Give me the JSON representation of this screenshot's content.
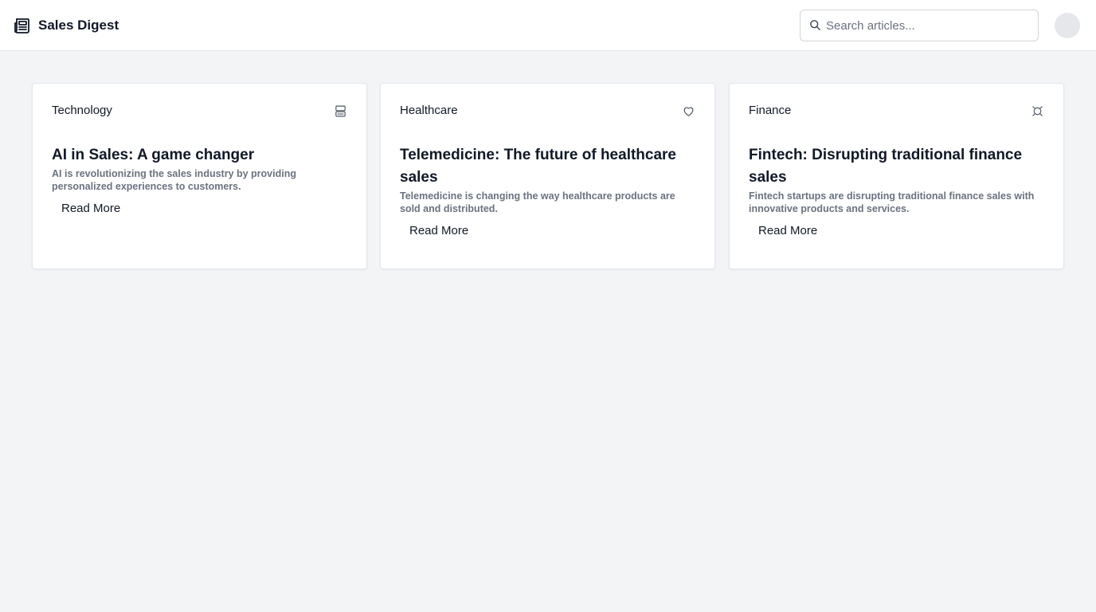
{
  "header": {
    "brand_icon": "newspaper-icon",
    "title": "Sales Digest",
    "search": {
      "icon": "search-icon",
      "placeholder": "Search articles...",
      "value": ""
    },
    "avatar_icon": "avatar"
  },
  "articles": [
    {
      "category": "Technology",
      "icon": "server-icon",
      "title": "AI in Sales: A game changer",
      "description": "AI is revolutionizing the sales industry by providing personalized experiences to customers.",
      "cta": "Read More"
    },
    {
      "category": "Healthcare",
      "icon": "heart-icon",
      "title": "Telemedicine: The future of healthcare sales",
      "description": "Telemedicine is changing the way healthcare products are sold and distributed.",
      "cta": "Read More"
    },
    {
      "category": "Finance",
      "icon": "currency-icon",
      "title": "Fintech: Disrupting traditional finance sales",
      "description": "Fintech startups are disrupting traditional finance sales with innovative products and services.",
      "cta": "Read More"
    }
  ],
  "colors": {
    "page_background": "#f3f4f6",
    "card_background": "#ffffff",
    "text_primary": "#111827",
    "text_muted": "#6b7280",
    "border": "#e5e7eb"
  }
}
